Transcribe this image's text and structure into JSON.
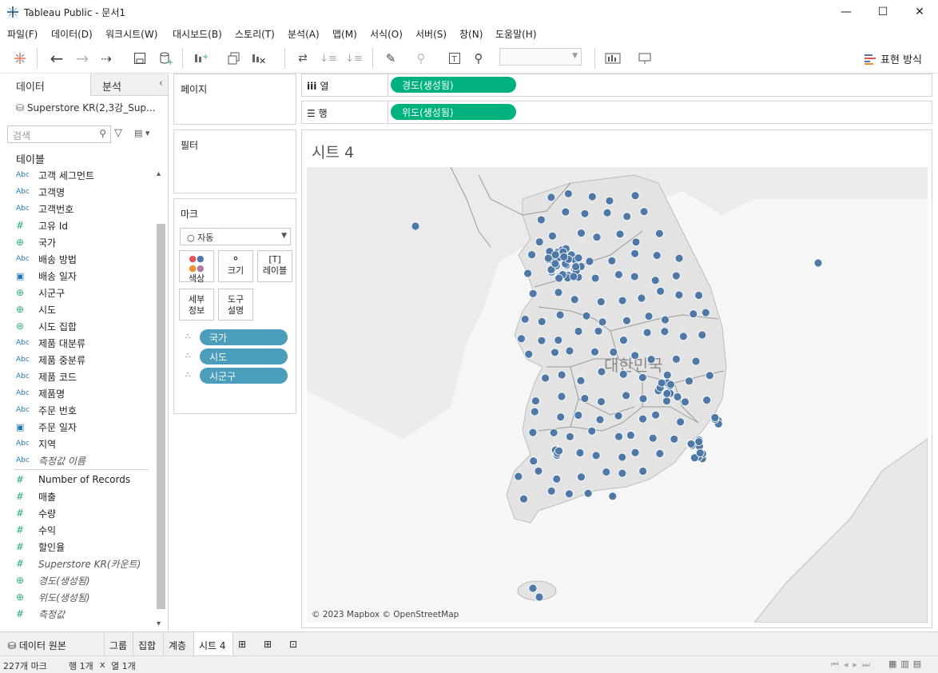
{
  "window": {
    "title": "Tableau Public - 문서1"
  },
  "menu": [
    "파일(F)",
    "데이터(D)",
    "워크시트(W)",
    "대시보드(B)",
    "스토리(T)",
    "분석(A)",
    "맵(M)",
    "서식(O)",
    "서버(S)",
    "창(N)",
    "도움말(H)"
  ],
  "toolbar": {
    "show_me": "표현 방식"
  },
  "left_pane": {
    "tab_data": "데이터",
    "tab_analysis": "분석",
    "datasource": "Superstore KR(2,3강_Sup...",
    "search_placeholder": "검색",
    "tables_header": "테이블",
    "dimensions": [
      {
        "type": "Abc",
        "name": "고객 세그먼트"
      },
      {
        "type": "Abc",
        "name": "고객명"
      },
      {
        "type": "Abc",
        "name": "고객번호"
      },
      {
        "type": "#",
        "name": "고유 Id"
      },
      {
        "type": "globe",
        "name": "국가"
      },
      {
        "type": "Abc",
        "name": "배송 방법"
      },
      {
        "type": "cal",
        "name": "배송 일자"
      },
      {
        "type": "globe",
        "name": "시군구"
      },
      {
        "type": "globe",
        "name": "시도"
      },
      {
        "type": "set",
        "name": "시도 집합"
      },
      {
        "type": "Abc",
        "name": "제품 대분류"
      },
      {
        "type": "Abc",
        "name": "제품 중분류"
      },
      {
        "type": "Abc",
        "name": "제품 코드"
      },
      {
        "type": "Abc",
        "name": "제품명"
      },
      {
        "type": "Abc",
        "name": "주문 번호"
      },
      {
        "type": "cal",
        "name": "주문 일자"
      },
      {
        "type": "Abc",
        "name": "지역"
      },
      {
        "type": "Abc",
        "name": "측정값 이름",
        "italic": true
      }
    ],
    "measures": [
      {
        "type": "#",
        "name": "Number of Records"
      },
      {
        "type": "#",
        "name": "매출"
      },
      {
        "type": "#",
        "name": "수량"
      },
      {
        "type": "#",
        "name": "수익"
      },
      {
        "type": "#",
        "name": "할인율"
      },
      {
        "type": "#",
        "name": "Superstore KR(카운트)",
        "italic": true
      },
      {
        "type": "globe",
        "name": "경도(생성됨)",
        "italic": true
      },
      {
        "type": "globe",
        "name": "위도(생성됨)",
        "italic": true
      },
      {
        "type": "#",
        "name": "측정값",
        "italic": true
      }
    ]
  },
  "cards": {
    "pages": "페이지",
    "filters": "필터",
    "marks": "마크",
    "mark_type": "자동",
    "buttons": [
      "색상",
      "크기",
      "레이블",
      "세부\n정보",
      "도구\n설명"
    ],
    "detail_pills": [
      "국가",
      "시도",
      "시군구"
    ]
  },
  "shelves": {
    "columns_label": "열",
    "rows_label": "행",
    "columns_pill": "경도(생성됨)",
    "rows_pill": "위도(생성됨)"
  },
  "viz": {
    "sheet_title": "시트 4",
    "map_label": "대한민국",
    "attribution": "© 2023 Mapbox © OpenStreetMap",
    "mark_color": "#4e79a7"
  },
  "tabs": [
    "데이터 원본",
    "그룹",
    "집합",
    "계층",
    "시트 4"
  ],
  "status": {
    "marks": "227개 마크",
    "rows": "행 1개",
    "x": "x",
    "cols": "열 1개"
  }
}
